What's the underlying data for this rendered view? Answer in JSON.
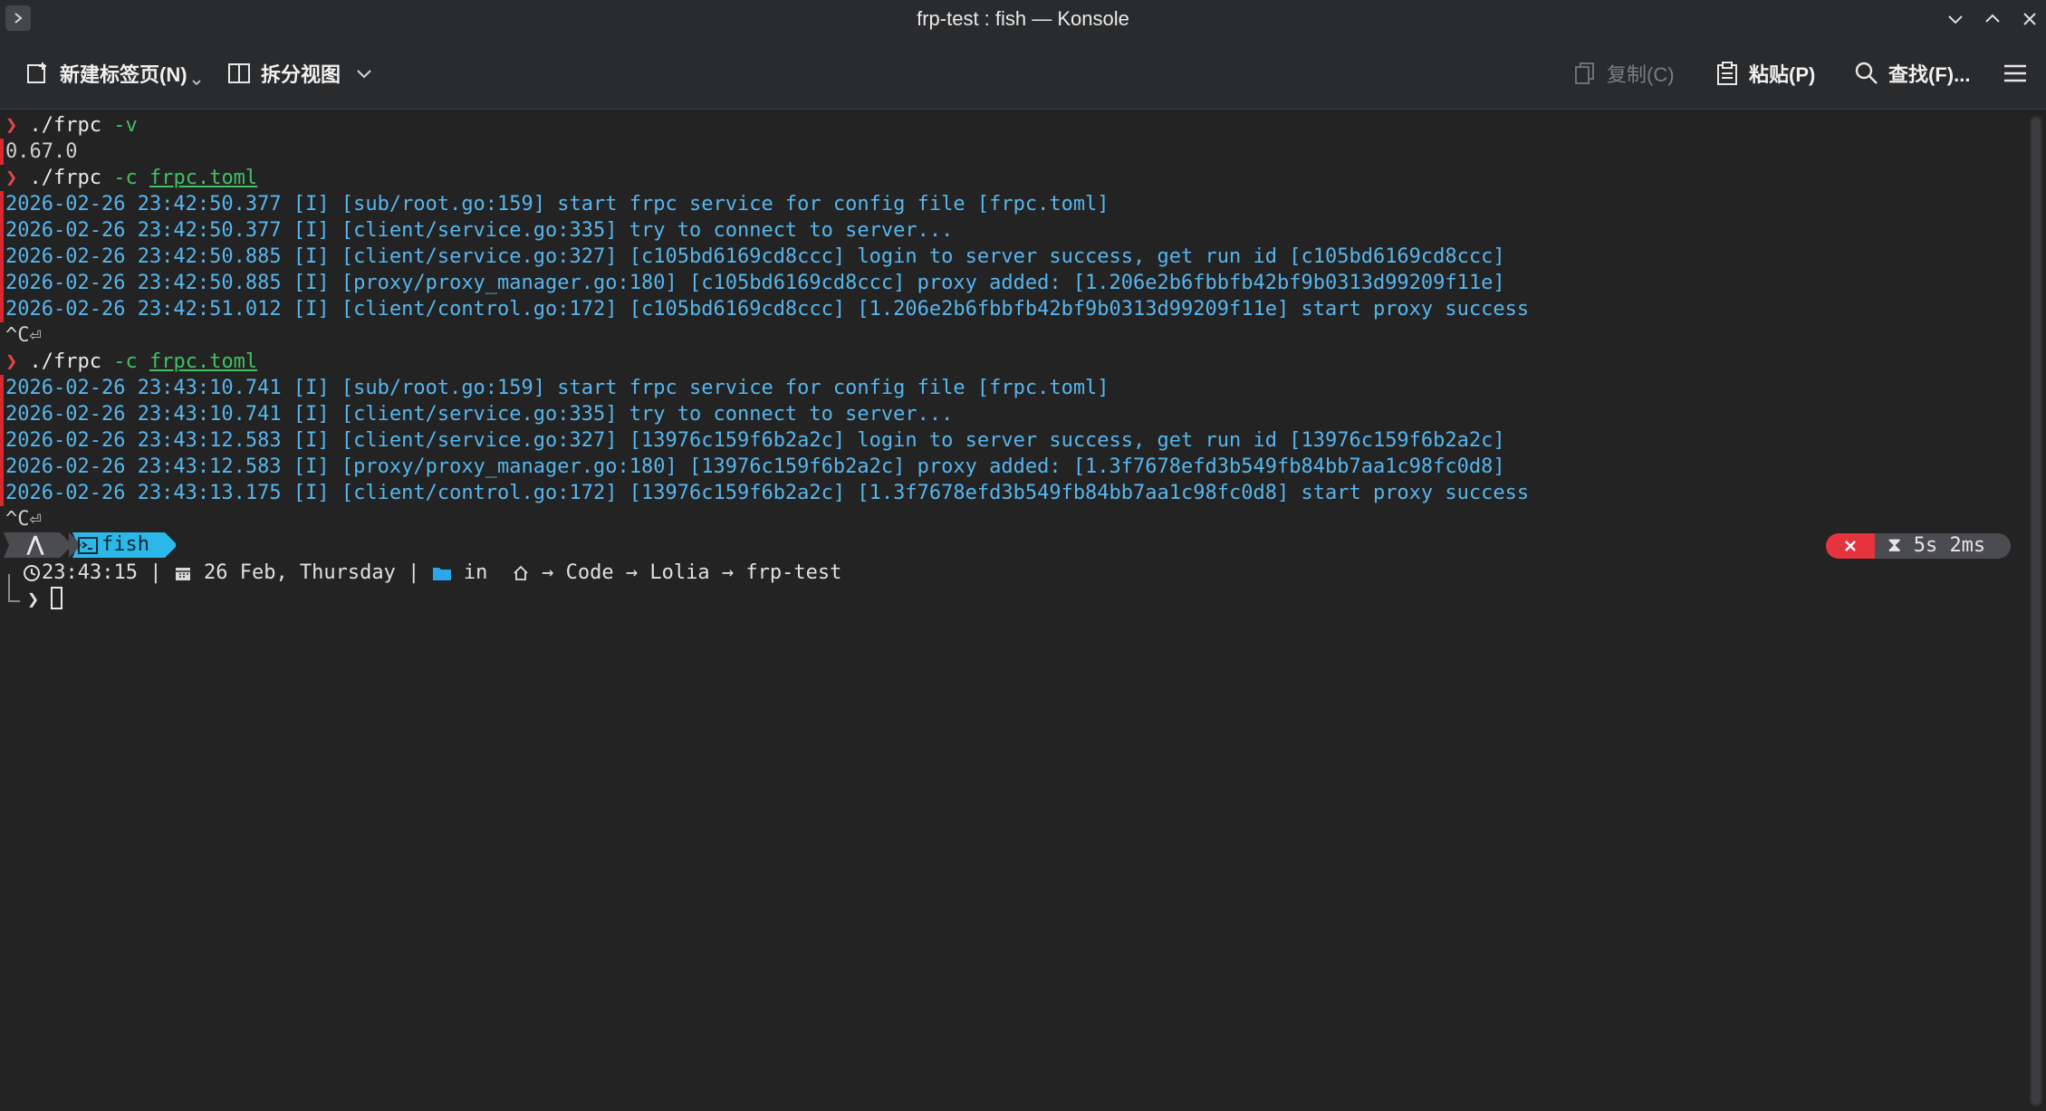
{
  "window": {
    "title": "frp-test : fish — Konsole",
    "menu_glyph": ">"
  },
  "toolbar": {
    "new_tab": "新建标签页(N)",
    "split_view": "拆分视图",
    "copy": "复制(C)",
    "paste": "粘贴(P)",
    "find": "查找(F)..."
  },
  "terminal": {
    "lines": [
      {
        "prompt": "❯",
        "cmd": " ./frpc",
        "arg": " -v",
        "file": ""
      },
      {
        "text": "0.67.0"
      },
      {
        "prompt": "❯",
        "cmd": " ./frpc",
        "arg": " -c",
        "file": "frpc.toml"
      },
      {
        "log": "2026-02-26 23:42:50.377 [I] [sub/root.go:159] start frpc service for config file [frpc.toml]"
      },
      {
        "log": "2026-02-26 23:42:50.377 [I] [client/service.go:335] try to connect to server..."
      },
      {
        "log": "2026-02-26 23:42:50.885 [I] [client/service.go:327] [c105bd6169cd8ccc] login to server success, get run id [c105bd6169cd8ccc]"
      },
      {
        "log": "2026-02-26 23:42:50.885 [I] [proxy/proxy_manager.go:180] [c105bd6169cd8ccc] proxy added: [1.206e2b6fbbfb42bf9b0313d99209f11e]"
      },
      {
        "log": "2026-02-26 23:42:51.012 [I] [client/control.go:172] [c105bd6169cd8ccc] [1.206e2b6fbbfb42bf9b0313d99209f11e] start proxy success"
      },
      {
        "text": "^C⏎"
      },
      {
        "prompt": "❯",
        "cmd": " ./frpc",
        "arg": " -c",
        "file": "frpc.toml"
      },
      {
        "log": "2026-02-26 23:43:10.741 [I] [sub/root.go:159] start frpc service for config file [frpc.toml]"
      },
      {
        "log": "2026-02-26 23:43:10.741 [I] [client/service.go:335] try to connect to server..."
      },
      {
        "log": "2026-02-26 23:43:12.583 [I] [client/service.go:327] [13976c159f6b2a2c] login to server success, get run id [13976c159f6b2a2c]"
      },
      {
        "log": "2026-02-26 23:43:12.583 [I] [proxy/proxy_manager.go:180] [13976c159f6b2a2c] proxy added: [1.3f7678efd3b549fb84bb7aa1c98fc0d8]"
      },
      {
        "log": "2026-02-26 23:43:13.175 [I] [client/control.go:172] [13976c159f6b2a2c] [1.3f7678efd3b549fb84bb7aa1c98fc0d8] start proxy success"
      },
      {
        "text": "^C⏎"
      }
    ],
    "prompt_line": {
      "shell": "fish",
      "time": "23:43:15",
      "date": "26 Feb, Thursday",
      "in_label": "in",
      "path": [
        "Code",
        "Lolia",
        "frp-test"
      ],
      "duration": "5s 2ms",
      "separator": "|"
    }
  },
  "colors": {
    "log": "#56b6ee",
    "arg": "#41c064",
    "prompt": "#e84545",
    "shell_segment": "#2bb8e8",
    "error_segment": "#e5343e",
    "duration_segment": "#4b4c4f"
  }
}
